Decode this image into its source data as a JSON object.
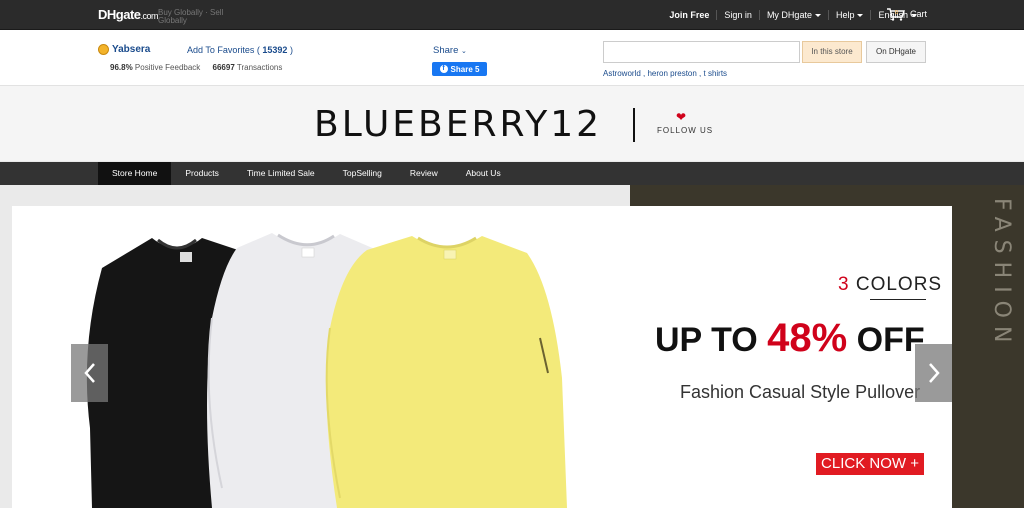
{
  "topbar": {
    "logo": "DHgate",
    "logo_suffix": ".com",
    "tagline": "Buy Globally · Sell Globally",
    "nav": [
      "Join Free",
      "Sign in",
      "My DHgate",
      "Help",
      "English"
    ],
    "cart_label": "Cart",
    "cart_count": "0"
  },
  "store": {
    "name": "Yabsera",
    "favorites_label": "Add To Favorites (",
    "favorites_count": "15392",
    "favorites_close": ")",
    "positive_feedback_value": "96.8%",
    "positive_feedback_label": "Positive Feedback",
    "transactions_value": "66697",
    "transactions_label": "Transactions",
    "share_label": "Share",
    "fb_share_label": "Share 5"
  },
  "search": {
    "value": "",
    "in_store_label": "In this store",
    "on_dhgate_label": "On DHgate",
    "hot_words": "Astroworld , heron preston , t shirts"
  },
  "brand": {
    "name": "BLUEBERRY12",
    "follow_label": "FOLLOW US"
  },
  "store_nav": {
    "items": [
      "Store Home",
      "Products",
      "Time Limited Sale",
      "TopSelling",
      "Review",
      "About Us"
    ]
  },
  "hero": {
    "colors_count": "3",
    "colors_label": "COLORS",
    "offer_prefix": "UP TO ",
    "offer_percent": "48%",
    "offer_suffix": " OFF",
    "subtitle": "Fashion Casual Style Pullover",
    "cta_label": "CLICK NOW +",
    "side_text": "FASHION"
  },
  "colors": {
    "accent_red": "#d0021b",
    "link_blue": "#1a4b8c",
    "topbar_bg": "#2b2b2b"
  }
}
